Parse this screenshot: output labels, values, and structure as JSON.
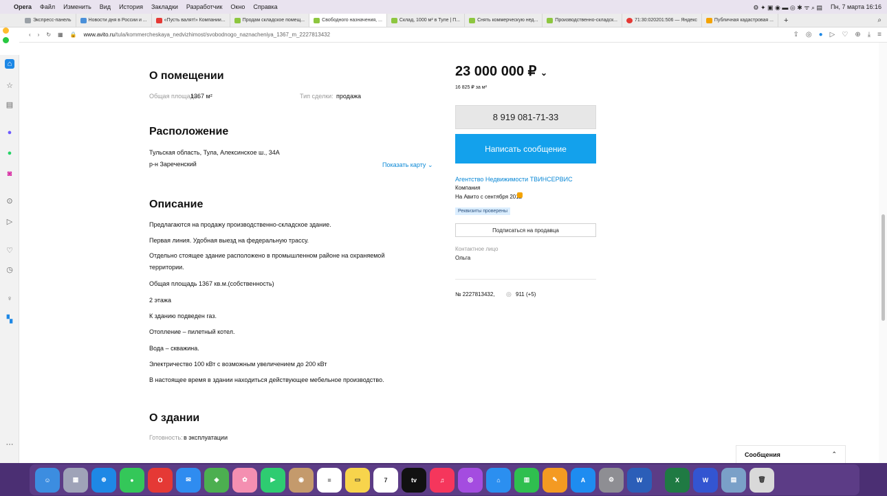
{
  "menubar": {
    "app": "Opera",
    "items": [
      "Файл",
      "Изменить",
      "Вид",
      "История",
      "Закладки",
      "Разработчик",
      "Окно",
      "Справка"
    ],
    "clock": "Пн, 7 марта 16:16"
  },
  "tabs": [
    {
      "label": "Экспресс-панель",
      "color": "#9aa0a6"
    },
    {
      "label": "Новости дня в России и ...",
      "color": "#4a90d9"
    },
    {
      "label": "«Пусть валят!» Компании...",
      "color": "#e53935"
    },
    {
      "label": "Продам складское помещ...",
      "color": "#8dc63f"
    },
    {
      "label": "Свободного назначения, ...",
      "color": "#8dc63f"
    },
    {
      "label": "Склад, 1000 м² в Туле | П...",
      "color": "#8dc63f"
    },
    {
      "label": "Снять коммерческую нед...",
      "color": "#8dc63f"
    },
    {
      "label": "Производственно-складск...",
      "color": "#8dc63f"
    },
    {
      "label": "71:30:020201:506 — Яндекс",
      "color": "#e53935"
    },
    {
      "label": "Публичная кадастровая ...",
      "color": "#f4a300"
    }
  ],
  "address": {
    "domain": "www.avito.ru",
    "path": "/tula/kommercheskaya_nedvizhimost/svobodnogo_naznacheniya_1367_m_2227813432"
  },
  "about": {
    "title": "О помещении",
    "area_label": "Общая площадь:",
    "area_value": "1367 м²",
    "deal_label": "Тип сделки:",
    "deal_value": "продажа"
  },
  "location": {
    "title": "Расположение",
    "address": "Тульская область, Тула, Алексинское ш., 34А",
    "district": "р-н Зареченский",
    "map_link": "Показать карту"
  },
  "description": {
    "title": "Описание",
    "lines": [
      "Предлагаются на продажу производственно-складское здание.",
      "Первая линия. Удобная выезд на федеральную трассу.",
      "Отдельно стоящее здание расположено в промышленном районе на охраняемой",
      "территории.",
      "Общая площадь 1367 кв.м.(собственность)",
      "2 этажа",
      "К зданию подведен газ.",
      "Отопление – пилетный котел.",
      "Вода – скважина.",
      "Электричество 100 кВт с возможным увеличением до 200 кВт",
      "В настоящее время в здании находиться действующее мебельное производство."
    ]
  },
  "building": {
    "title": "О здании",
    "ready_label": "Готовность:",
    "ready_value": "в эксплуатации"
  },
  "offer": {
    "price": "23 000 000 ₽",
    "price_per_m": "16 825 ₽ за м²",
    "phone": "8 919 081-71-33",
    "message_btn": "Написать сообщение",
    "seller": "Агентство Недвижимости ТВИНСЕРВИС",
    "seller_type": "Компания",
    "since": "На Авито с сентября 2012",
    "verified": "Реквизиты проверены",
    "subscribe": "Подписаться на продавца",
    "contact_label": "Контактное лицо",
    "contact_name": "Ольга",
    "ad_number": "№ 2227813432,",
    "views": "911 (+5)"
  },
  "messages": {
    "label": "Сообщения"
  },
  "dock": [
    {
      "name": "finder",
      "color": "#3c8de0",
      "glyph": "☺"
    },
    {
      "name": "launchpad",
      "color": "#9fa3b8",
      "glyph": "▦"
    },
    {
      "name": "safari",
      "color": "#1e88e5",
      "glyph": "⊕"
    },
    {
      "name": "messages",
      "color": "#34c759",
      "glyph": "●"
    },
    {
      "name": "opera",
      "color": "#e53935",
      "glyph": "O"
    },
    {
      "name": "mail",
      "color": "#2f8cf0",
      "glyph": "✉"
    },
    {
      "name": "maps",
      "color": "#4caf50",
      "glyph": "◈"
    },
    {
      "name": "photos",
      "color": "#f48fb1",
      "glyph": "✿"
    },
    {
      "name": "facetime",
      "color": "#2ecc71",
      "glyph": "▶"
    },
    {
      "name": "contacts",
      "color": "#c49a6c",
      "glyph": "◉"
    },
    {
      "name": "reminders",
      "color": "#ffffff",
      "glyph": "≡"
    },
    {
      "name": "notes",
      "color": "#f7d44c",
      "glyph": "▭"
    },
    {
      "name": "calendar",
      "color": "#ffffff",
      "glyph": "7"
    },
    {
      "name": "apple-tv",
      "color": "#111111",
      "glyph": "tv"
    },
    {
      "name": "music",
      "color": "#f5365c",
      "glyph": "♫"
    },
    {
      "name": "podcasts",
      "color": "#a44ce0",
      "glyph": "◎"
    },
    {
      "name": "keynote",
      "color": "#2b8ff0",
      "glyph": "⌂"
    },
    {
      "name": "numbers",
      "color": "#2fbf4f",
      "glyph": "▥"
    },
    {
      "name": "pages",
      "color": "#f49a22",
      "glyph": "✎"
    },
    {
      "name": "app-store",
      "color": "#1e8cf0",
      "glyph": "A"
    },
    {
      "name": "system-preferences",
      "color": "#8e8e93",
      "glyph": "⚙"
    },
    {
      "name": "word",
      "color": "#2b5eb8",
      "glyph": "W"
    },
    {
      "name": "excel",
      "color": "#1f7a43",
      "glyph": "X"
    },
    {
      "name": "word-2",
      "color": "#3355d1",
      "glyph": "W"
    },
    {
      "name": "preview",
      "color": "#7aa0c8",
      "glyph": "▤"
    },
    {
      "name": "trash",
      "color": "#d9d9d9",
      "glyph": "🗑"
    }
  ]
}
